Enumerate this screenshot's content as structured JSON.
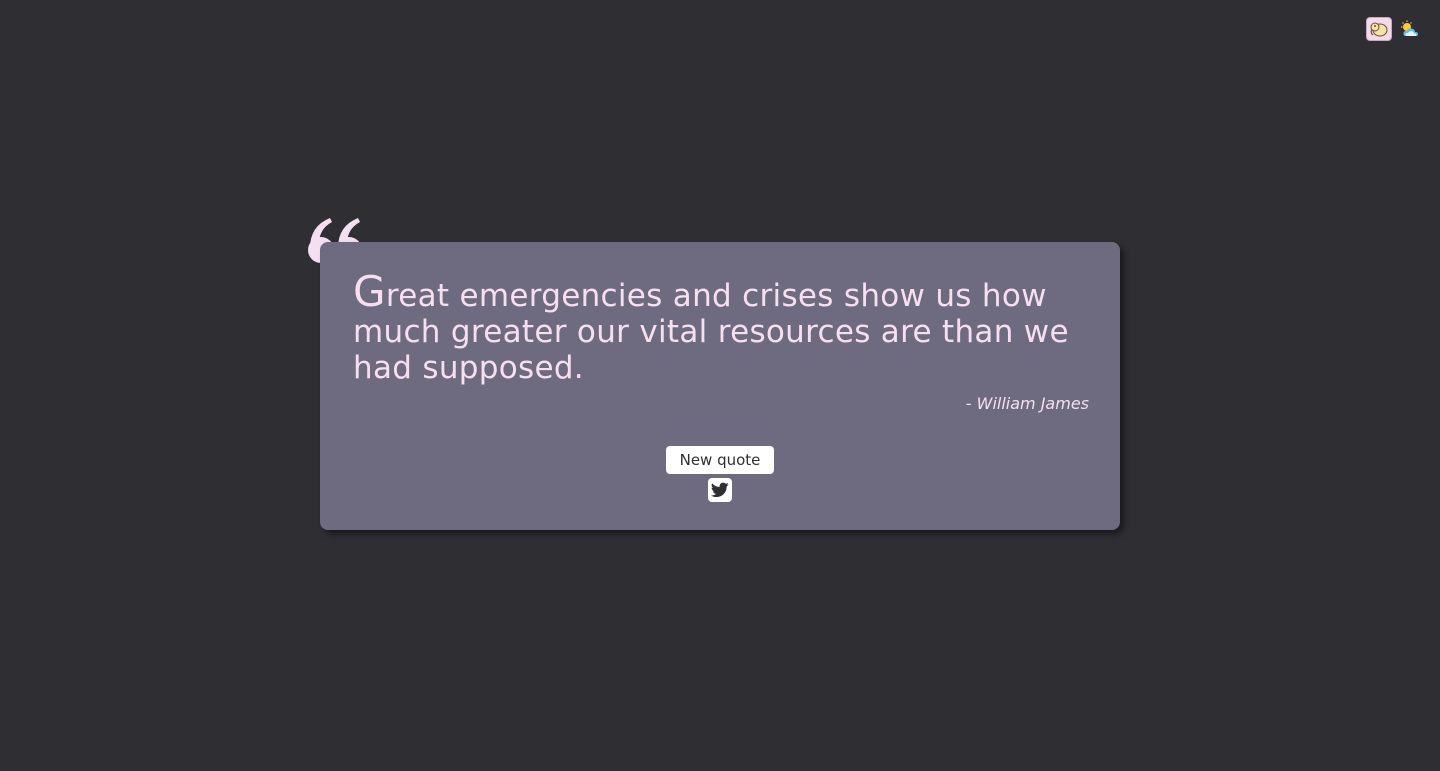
{
  "header": {
    "theme_icon": "elephant-theme-icon",
    "weather_icon": "sun-cloud-icon"
  },
  "quote": {
    "first_letter": "G",
    "text_rest": "reat emergencies and crises show us how much greater our vital resources are than we had supposed.",
    "author": "- William James"
  },
  "actions": {
    "new_quote_label": "New quote",
    "tweet_icon": "twitter-icon"
  },
  "colors": {
    "background": "#2f2e33",
    "card": "#6e6b80",
    "text": "#f5dff0",
    "quote_mark": "#f3dff0"
  }
}
